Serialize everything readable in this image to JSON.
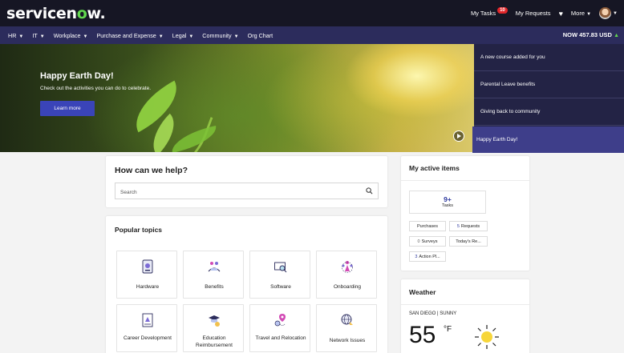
{
  "brand": {
    "logo_prefix": "servicen",
    "logo_o": "o",
    "logo_suffix": "w."
  },
  "topbar": {
    "my_tasks": "My Tasks",
    "my_tasks_count": "10",
    "my_requests": "My Requests",
    "more": "More"
  },
  "nav": {
    "items": [
      "HR",
      "IT",
      "Workplace",
      "Purchase and Expense",
      "Legal",
      "Community",
      "Org Chart"
    ],
    "dropdown_flags": [
      true,
      true,
      true,
      true,
      true,
      true,
      false
    ],
    "now_balance": "NOW 457.83 USD"
  },
  "hero": {
    "title": "Happy Earth Day!",
    "subtitle": "Check out the activities you can do to celebrate.",
    "button": "Learn more"
  },
  "carousel": {
    "slides": [
      "A new course added for you",
      "Parental Leave benefits",
      "Giving back to community",
      "Happy Earth Day!"
    ]
  },
  "help": {
    "title": "How can we help?",
    "search_placeholder": "Search"
  },
  "popular": {
    "title": "Popular topics",
    "tiles": [
      {
        "label": "Hardware",
        "icon": "hardware-icon"
      },
      {
        "label": "Benefits",
        "icon": "benefits-icon"
      },
      {
        "label": "Software",
        "icon": "software-icon"
      },
      {
        "label": "Onboarding",
        "icon": "onboarding-icon"
      },
      {
        "label": "Career Development",
        "icon": "career-development-icon"
      },
      {
        "label": "Education Reimbursement",
        "icon": "education-icon"
      },
      {
        "label": "Travel and Relocation",
        "icon": "travel-icon"
      },
      {
        "label": "Network Issues",
        "icon": "network-icon"
      }
    ]
  },
  "active_items": {
    "title": "My active items",
    "tasks_count": "9+",
    "tasks_label": "Tasks",
    "purchases": "Purchases",
    "requests_count": "5",
    "requests_label": "Requests",
    "surveys_count": "0",
    "surveys_label": "Surveys",
    "todays": "Today's Re...",
    "actions_count": "3",
    "actions_label": "Action Pl..."
  },
  "weather": {
    "title": "Weather",
    "location": "SAN DIEGO | SUNNY",
    "temp": "55",
    "unit": "°F"
  },
  "colors": {
    "topbar": "#161624",
    "navbar": "#2c2c5c",
    "accent": "#3a44b8",
    "brand_green": "#62d84e"
  }
}
